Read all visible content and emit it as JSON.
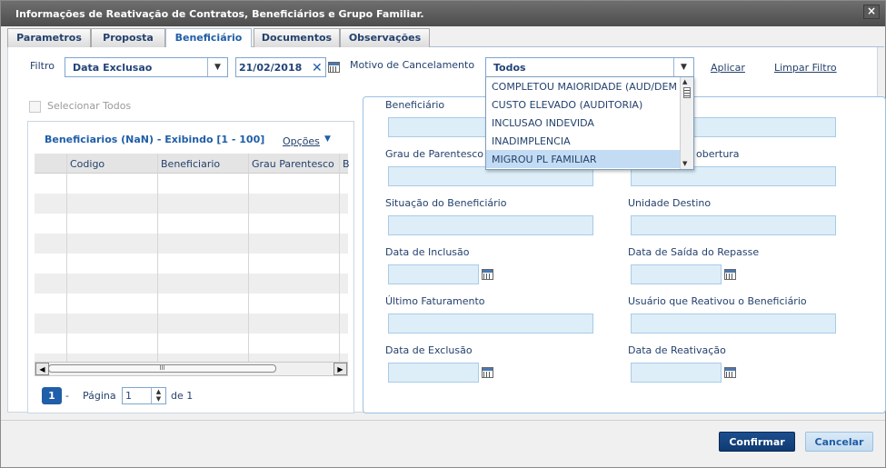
{
  "window": {
    "title": "Informações de Reativação de Contratos, Beneficiários e Grupo Familiar."
  },
  "tabs": [
    {
      "label": "Parametros"
    },
    {
      "label": "Proposta"
    },
    {
      "label": "Beneficiário"
    },
    {
      "label": "Documentos"
    },
    {
      "label": "Observações"
    }
  ],
  "filter": {
    "label": "Filtro",
    "type_value": "Data Exclusao",
    "date_value": "21/02/2018",
    "motivo_label": "Motivo de Cancelamento",
    "motivo_value": "Todos",
    "apply_label": "Aplicar",
    "clear_label": "Limpar Filtro"
  },
  "dropdown": {
    "options": [
      "COMPLETOU MAIORIDADE (AUD/DEM",
      "CUSTO ELEVADO (AUDITORIA)",
      "INCLUSAO INDEVIDA",
      "INADIMPLENCIA",
      "MIGROU PL FAMILIAR"
    ],
    "highlighted": "MIGROU PL FAMILIAR"
  },
  "select_all_label": "Selecionar Todos",
  "grid": {
    "title": "Beneficiarios (NaN) - Exibindo [1 - 100]",
    "options_label": "Opções",
    "columns": [
      "Codigo",
      "Beneficiario",
      "Grau Parentesco",
      "B"
    ],
    "page_button": "1",
    "dash": "-",
    "page_label": "Página",
    "page_value": "1",
    "of_label": "de 1"
  },
  "detail": {
    "beneficiario": "Beneficiário",
    "grau": "Grau de Parentesco",
    "cobertura": "obertura",
    "situacao": "Situação do Beneficiário",
    "unidade": "Unidade Destino",
    "data_inclusao": "Data de Inclusão",
    "data_saida": "Data de Saída do Repasse",
    "ultimo_fat": "Último Faturamento",
    "usuario": "Usuário que Reativou o Beneficiário",
    "data_exclusao": "Data de Exclusão",
    "data_reativacao": "Data de Reativação"
  },
  "footer": {
    "confirm": "Confirmar",
    "cancel": "Cancelar"
  },
  "colors": {
    "primary": "#0f3a73",
    "accent": "#1f5ea8",
    "field_bg": "#ddeef8"
  }
}
